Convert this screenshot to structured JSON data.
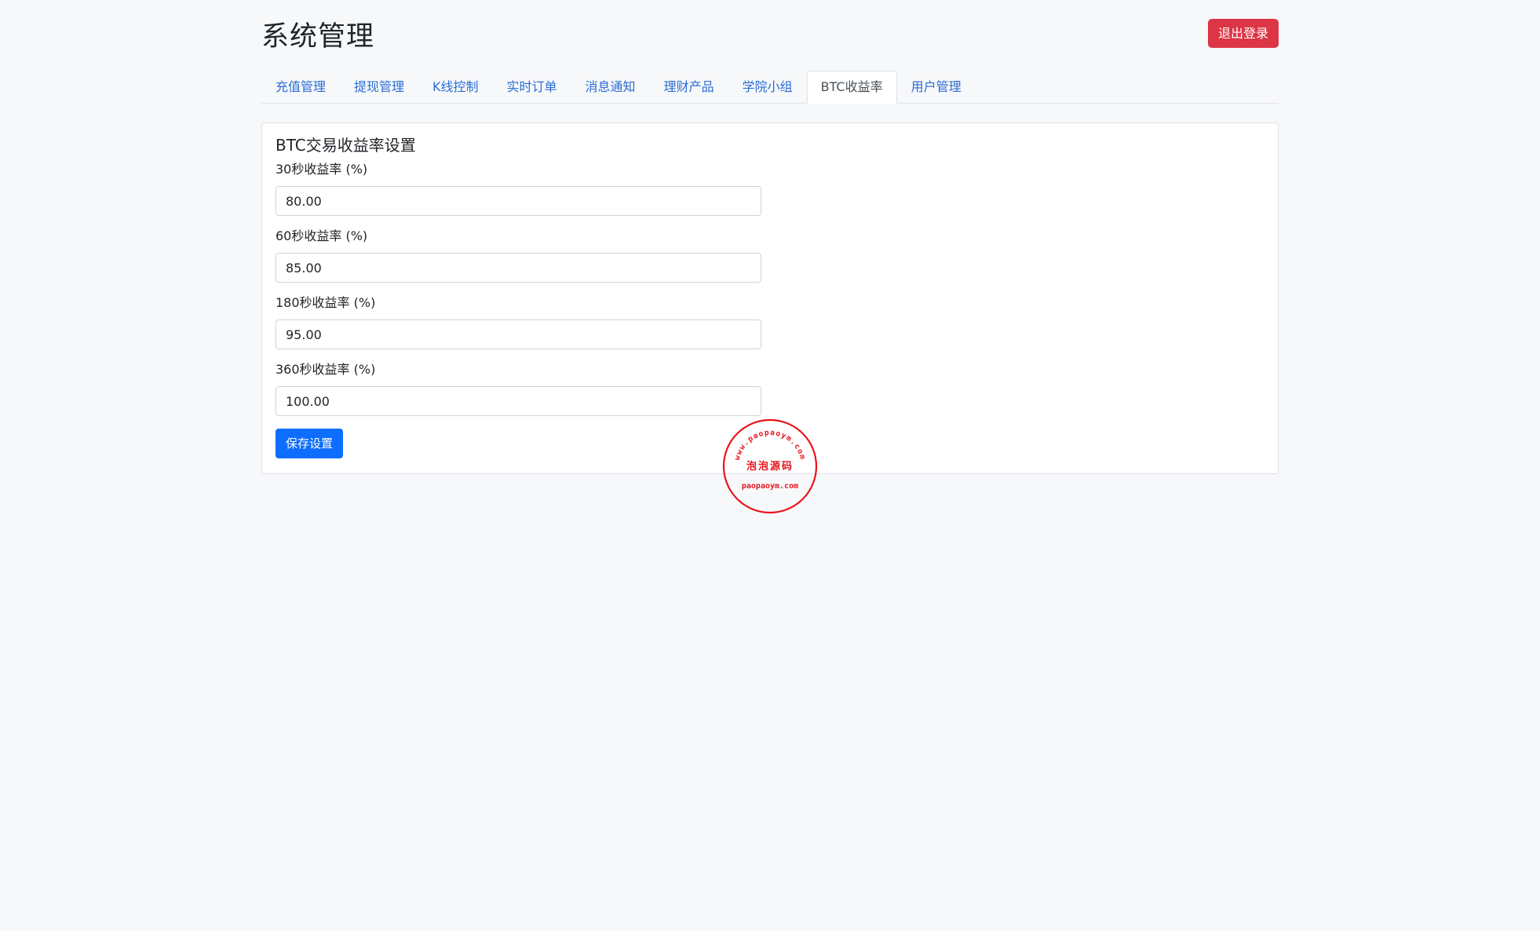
{
  "header": {
    "title": "系统管理",
    "logout_label": "退出登录"
  },
  "tabs": [
    {
      "label": "充值管理",
      "active": false
    },
    {
      "label": "提现管理",
      "active": false
    },
    {
      "label": "K线控制",
      "active": false
    },
    {
      "label": "实时订单",
      "active": false
    },
    {
      "label": "消息通知",
      "active": false
    },
    {
      "label": "理财产品",
      "active": false
    },
    {
      "label": "学院小组",
      "active": false
    },
    {
      "label": "BTC收益率",
      "active": true
    },
    {
      "label": "用户管理",
      "active": false
    }
  ],
  "settings": {
    "title": "BTC交易收益率设置",
    "fields": [
      {
        "label": "30秒收益率 (%)",
        "value": "80.00"
      },
      {
        "label": "60秒收益率 (%)",
        "value": "85.00"
      },
      {
        "label": "180秒收益率 (%)",
        "value": "95.00"
      },
      {
        "label": "360秒收益率 (%)",
        "value": "100.00"
      }
    ],
    "save_label": "保存设置"
  },
  "watermark": {
    "top_text": "www.paopaoym.com",
    "center_text": "泡泡源码",
    "bottom_text": "paopaoym.com"
  },
  "colors": {
    "danger": "#dc3545",
    "primary": "#0d6efd",
    "tab_link": "#2b6cd4",
    "stamp": "#e8141c"
  }
}
